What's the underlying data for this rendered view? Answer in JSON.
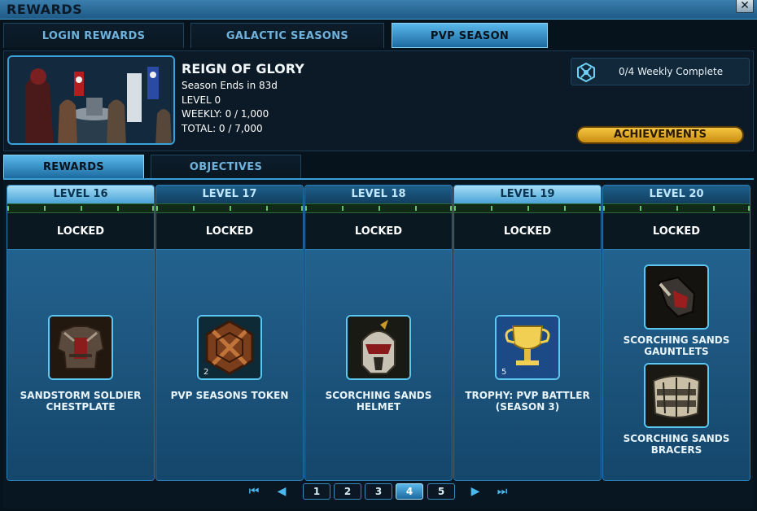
{
  "window": {
    "title": "REWARDS",
    "close_glyph": "✕"
  },
  "top_tabs": [
    {
      "label": "LOGIN REWARDS",
      "active": false
    },
    {
      "label": "GALACTIC SEASONS",
      "active": false
    },
    {
      "label": "PVP SEASON",
      "active": true
    }
  ],
  "season": {
    "title": "REIGN OF GLORY",
    "ends": "Season Ends in 83d",
    "level": "LEVEL 0",
    "weekly": "WEEKLY: 0 / 1,000",
    "total": "TOTAL: 0 / 7,000",
    "weekly_complete": "0/4 Weekly Complete",
    "achievements_label": "ACHIEVEMENTS"
  },
  "sub_tabs": [
    {
      "label": "REWARDS",
      "active": true
    },
    {
      "label": "OBJECTIVES",
      "active": false
    }
  ],
  "levels": [
    {
      "label": "LEVEL 16",
      "status": "LOCKED",
      "highlight": true,
      "rewards": [
        {
          "name": "SANDSTORM SOLDIER CHESTPLATE",
          "icon": "chestplate-icon",
          "qty": ""
        }
      ]
    },
    {
      "label": "LEVEL 17",
      "status": "LOCKED",
      "highlight": false,
      "rewards": [
        {
          "name": "PVP SEASONS TOKEN",
          "icon": "token-icon",
          "qty": "2"
        }
      ]
    },
    {
      "label": "LEVEL 18",
      "status": "LOCKED",
      "highlight": false,
      "rewards": [
        {
          "name": "SCORCHING SANDS HELMET",
          "icon": "helmet-icon",
          "qty": ""
        }
      ]
    },
    {
      "label": "LEVEL 19",
      "status": "LOCKED",
      "highlight": true,
      "rewards": [
        {
          "name": "TROPHY: PVP BATTLER (SEASON 3)",
          "icon": "trophy-icon",
          "qty": "5"
        }
      ]
    },
    {
      "label": "LEVEL 20",
      "status": "LOCKED",
      "highlight": false,
      "rewards": [
        {
          "name": "SCORCHING SANDS GAUNTLETS",
          "icon": "gauntlets-icon",
          "qty": ""
        },
        {
          "name": "SCORCHING SANDS BRACERS",
          "icon": "bracers-icon",
          "qty": ""
        }
      ]
    }
  ],
  "pager": {
    "first_glyph": "⏮",
    "prev_glyph": "◀",
    "next_glyph": "▶",
    "last_glyph": "⏭",
    "pages": [
      "1",
      "2",
      "3",
      "4",
      "5"
    ],
    "current_page": "4"
  }
}
